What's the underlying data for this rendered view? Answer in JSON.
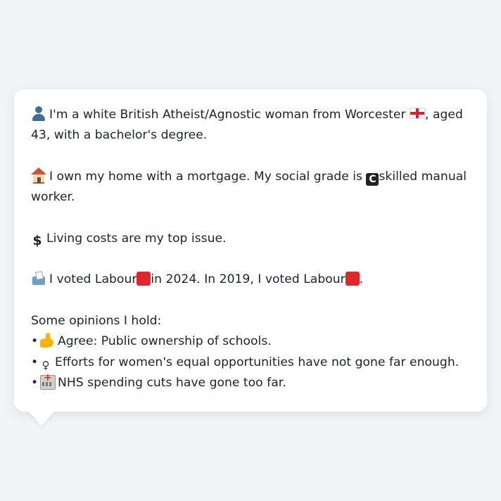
{
  "profile": {
    "identity_text": "I'm a white British Atheist/Agnostic woman from Worcester",
    "identity_text_2": ", aged 43, with a bachelor's degree.",
    "identity_icon": "person-silhouette-icon",
    "flag_icon": "england-flag-icon",
    "home_text": "I own my home with a mortgage. My social grade is",
    "home_text_2": "skilled manual worker.",
    "home_icon": "house-icon",
    "grade_letter": "C",
    "issue_text": "Living costs are my top issue.",
    "issue_icon": "dollar-sign-icon",
    "vote_text_1": "I voted Labour",
    "vote_text_2": "in 2024. In 2019, I voted Labour",
    "vote_text_3": ".",
    "vote_icon": "ballot-box-icon",
    "party_color": "#e0272b",
    "opinions_heading": "Some opinions I hold:",
    "opinions": [
      {
        "bullet": "•",
        "icon": "thumbs-up-icon",
        "text": "Agree: Public ownership of schools."
      },
      {
        "bullet": "•",
        "icon": "female-sign-icon",
        "glyph": "♀",
        "text": "Efforts for women's equal opportunities have not gone far enough."
      },
      {
        "bullet": "•",
        "icon": "hospital-icon",
        "text": "NHS spending cuts have gone too far."
      }
    ]
  }
}
